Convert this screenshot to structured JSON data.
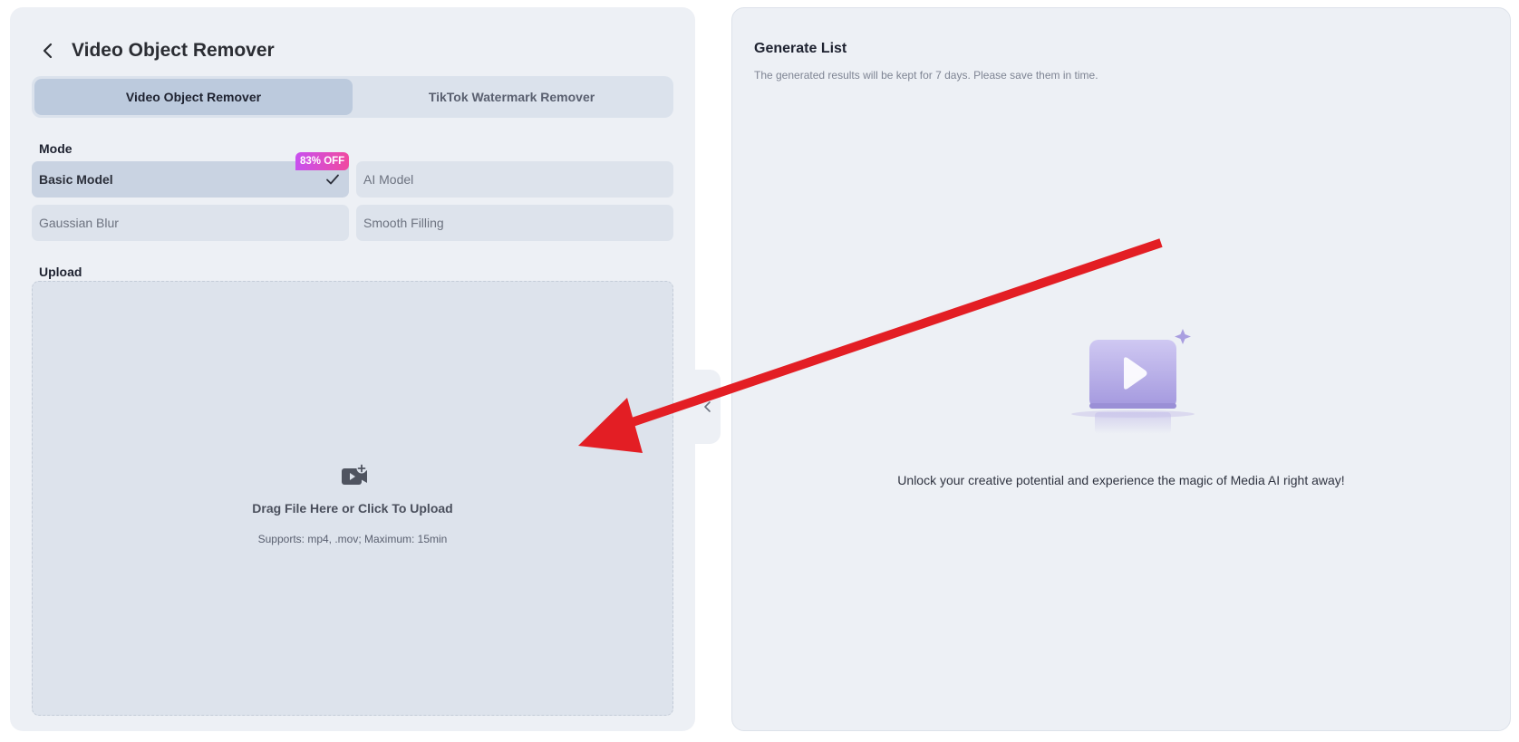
{
  "header": {
    "title": "Video Object Remover"
  },
  "tabs": [
    {
      "label": "Video Object Remover",
      "active": true
    },
    {
      "label": "TikTok Watermark Remover",
      "active": false
    }
  ],
  "mode": {
    "label": "Mode",
    "badge": "83% OFF",
    "options": [
      {
        "label": "Basic Model",
        "selected": true
      },
      {
        "label": "AI Model",
        "selected": false
      },
      {
        "label": "Gaussian Blur",
        "selected": false
      },
      {
        "label": "Smooth Filling",
        "selected": false
      }
    ]
  },
  "upload": {
    "label": "Upload",
    "prompt": "Drag File Here or Click To Upload",
    "hint": "Supports: mp4, .mov; Maximum: 15min"
  },
  "generate": {
    "title": "Generate List",
    "subtitle": "The generated results will be kept for 7 days. Please save them in time.",
    "empty_message": "Unlock your creative potential and experience the magic of Media AI right away!"
  },
  "colors": {
    "panel_bg": "#edf0f5",
    "active_tab": "#bccadd",
    "badge_start": "#c850f0",
    "badge_end": "#f04aa0",
    "arrow": "#e31e24",
    "illustration": "#a99ee0"
  },
  "icons": {
    "back": "chevron-left-icon",
    "check": "check-icon",
    "upload": "video-add-icon",
    "collapse": "chevron-left-icon",
    "empty": "play-video-icon"
  }
}
